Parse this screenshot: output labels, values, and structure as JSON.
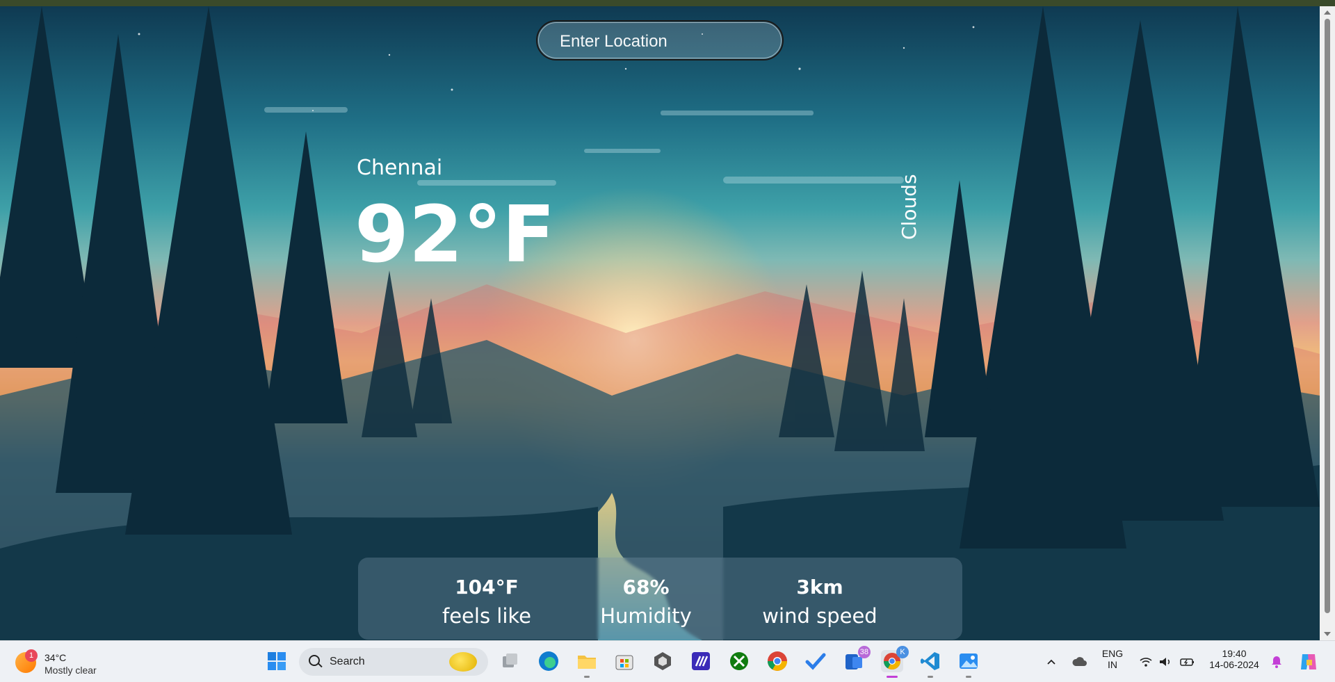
{
  "search": {
    "placeholder": "Enter Location",
    "value": ""
  },
  "weather": {
    "city": "Chennai",
    "temperature": "92°F",
    "condition": "Clouds",
    "stats": [
      {
        "value": "104°F",
        "label": "feels like"
      },
      {
        "value": "68%",
        "label": "Humidity"
      },
      {
        "value": "3km",
        "label": "wind speed"
      }
    ]
  },
  "taskbar": {
    "weather_widget": {
      "temp": "34°C",
      "condition": "Mostly clear",
      "badge": "1"
    },
    "search_label": "Search",
    "apps": [
      {
        "name": "start-button",
        "icon": "windows-logo-icon"
      },
      {
        "name": "task-view-button",
        "icon": "task-view-icon"
      },
      {
        "name": "edge-app",
        "icon": "edge-icon"
      },
      {
        "name": "file-explorer-app",
        "icon": "folder-icon"
      },
      {
        "name": "store-app",
        "icon": "store-icon"
      },
      {
        "name": "app-unity",
        "icon": "unity-icon"
      },
      {
        "name": "app-codeium",
        "icon": "codeium-icon"
      },
      {
        "name": "xbox-app",
        "icon": "xbox-icon"
      },
      {
        "name": "chrome-app",
        "icon": "chrome-icon"
      },
      {
        "name": "todo-app",
        "icon": "todo-check-icon"
      },
      {
        "name": "phone-link-app",
        "icon": "phone-link-icon",
        "badge": "38"
      },
      {
        "name": "chrome-profile-app",
        "icon": "chrome-icon",
        "badge": "K"
      },
      {
        "name": "vscode-app",
        "icon": "vscode-icon"
      },
      {
        "name": "photos-app",
        "icon": "photos-icon"
      }
    ],
    "tray": {
      "lang_top": "ENG",
      "lang_bottom": "IN",
      "time": "19:40",
      "date": "14-06-2024"
    }
  },
  "colors": {
    "scene_sky": "#1f6f86",
    "sun_glow": "#f2c07a",
    "panel": "#7896aa",
    "taskbar_bg": "#eef1f5",
    "active_indicator": "#c33fd6"
  }
}
